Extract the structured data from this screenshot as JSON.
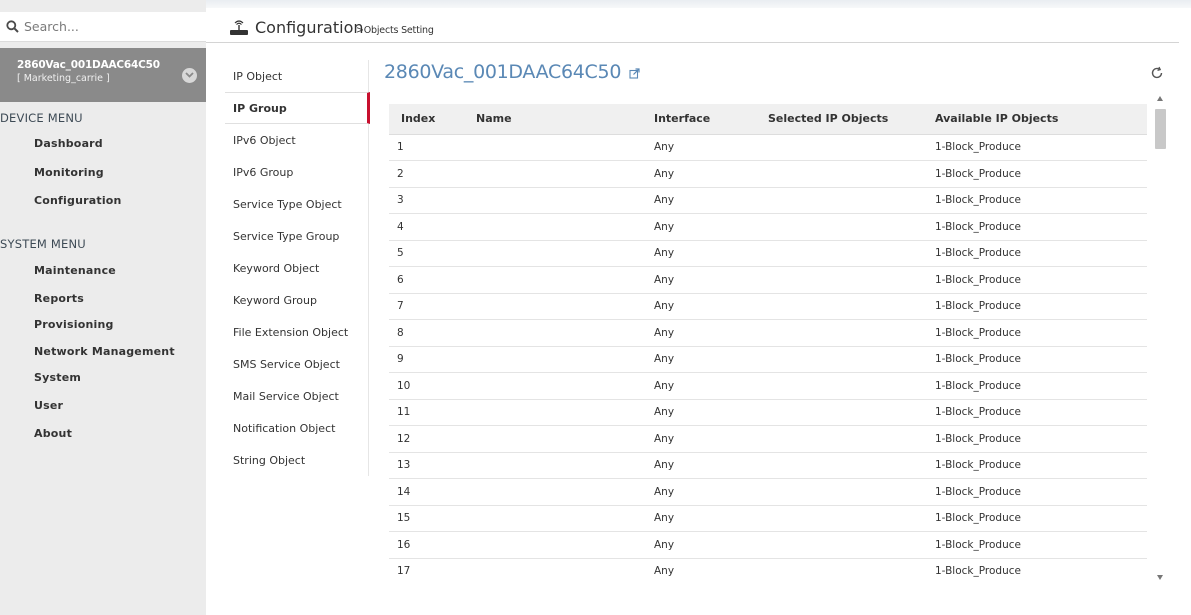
{
  "sidebar": {
    "search_placeholder": "Search...",
    "device": {
      "name": "2860Vac_001DAAC64C50",
      "user": "[ Marketing_carrie ]"
    },
    "device_menu_title": "DEVICE MENU",
    "device_menu": [
      "Dashboard",
      "Monitoring",
      "Configuration"
    ],
    "system_menu_title": "SYSTEM MENU",
    "system_menu": [
      "Maintenance",
      "Reports",
      "Provisioning",
      "Network Management",
      "System",
      "User",
      "About"
    ]
  },
  "header": {
    "title": "Configuration",
    "breadcrumb": ">Objects Setting"
  },
  "submenu": {
    "items": [
      "IP Object",
      "IP Group",
      "IPv6 Object",
      "IPv6 Group",
      "Service Type Object",
      "Service Type Group",
      "Keyword Object",
      "Keyword Group",
      "File Extension Object",
      "SMS Service Object",
      "Mail Service Object",
      "Notification Object",
      "String Object"
    ],
    "active": "IP Group"
  },
  "main": {
    "title": "2860Vac_001DAAC64C50",
    "table": {
      "columns": [
        "Index",
        "Name",
        "Interface",
        "Selected IP Objects",
        "Available IP Objects"
      ],
      "rows": [
        [
          "1",
          "",
          "Any",
          "",
          "1-Block_Produce"
        ],
        [
          "2",
          "",
          "Any",
          "",
          "1-Block_Produce"
        ],
        [
          "3",
          "",
          "Any",
          "",
          "1-Block_Produce"
        ],
        [
          "4",
          "",
          "Any",
          "",
          "1-Block_Produce"
        ],
        [
          "5",
          "",
          "Any",
          "",
          "1-Block_Produce"
        ],
        [
          "6",
          "",
          "Any",
          "",
          "1-Block_Produce"
        ],
        [
          "7",
          "",
          "Any",
          "",
          "1-Block_Produce"
        ],
        [
          "8",
          "",
          "Any",
          "",
          "1-Block_Produce"
        ],
        [
          "9",
          "",
          "Any",
          "",
          "1-Block_Produce"
        ],
        [
          "10",
          "",
          "Any",
          "",
          "1-Block_Produce"
        ],
        [
          "11",
          "",
          "Any",
          "",
          "1-Block_Produce"
        ],
        [
          "12",
          "",
          "Any",
          "",
          "1-Block_Produce"
        ],
        [
          "13",
          "",
          "Any",
          "",
          "1-Block_Produce"
        ],
        [
          "14",
          "",
          "Any",
          "",
          "1-Block_Produce"
        ],
        [
          "15",
          "",
          "Any",
          "",
          "1-Block_Produce"
        ],
        [
          "16",
          "",
          "Any",
          "",
          "1-Block_Produce"
        ],
        [
          "17",
          "",
          "Any",
          "",
          "1-Block_Produce"
        ]
      ]
    }
  },
  "colors": {
    "accent_blue": "#5a88b5",
    "active_marker": "#c8102e",
    "sidebar_bg": "#ececec",
    "device_box": "#8a8a8a"
  },
  "icons": {
    "search": "search-icon",
    "device_toggle": "chevron-down-icon",
    "header": "router-icon",
    "external_link": "external-link-icon",
    "refresh": "refresh-icon"
  }
}
